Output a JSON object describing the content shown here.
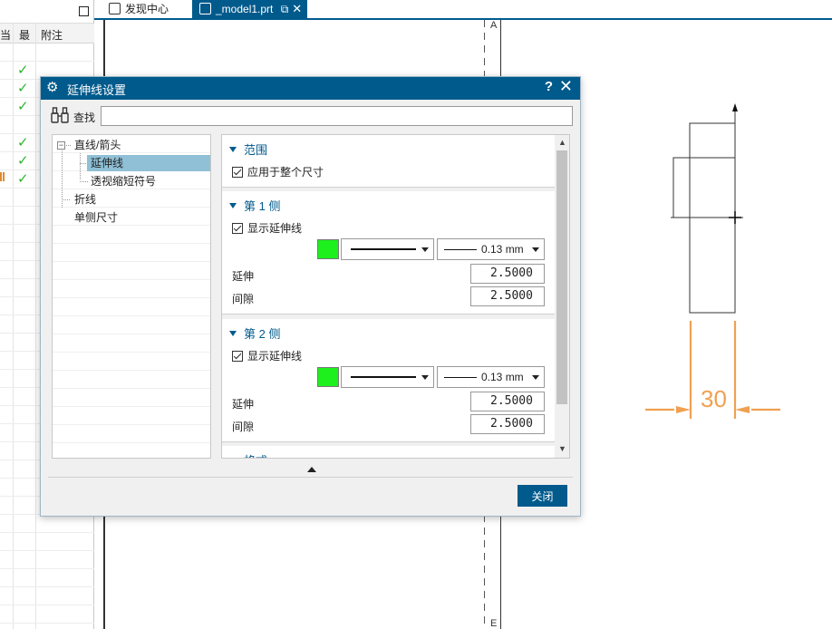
{
  "left_panel": {
    "columns": [
      "当",
      "最",
      "附注"
    ],
    "check_rows": [
      1,
      2,
      3,
      5,
      6,
      7
    ],
    "check_glyph": "✓"
  },
  "tabs": [
    {
      "label": "发现中心",
      "icon": "discovery-icon"
    },
    {
      "label": "_model1.prt",
      "icon": "part-file-icon",
      "active": true,
      "close": "✕"
    }
  ],
  "canvas": {
    "zone_letter_top": "A",
    "zone_letter_bottom": "E",
    "dimension_value": "30",
    "dimension_color": "#f0a050"
  },
  "dialog": {
    "title": "延伸线设置",
    "help": "?",
    "close_glyph": "✕",
    "find_label": "查找",
    "find_value": "",
    "tree": {
      "group_label": "直线/箭头",
      "items": [
        "延伸线",
        "透视缩短符号"
      ],
      "selected": "延伸线",
      "others": [
        "折线",
        "单侧尺寸"
      ]
    },
    "sections": {
      "range": {
        "title": "范围",
        "checkbox": "应用于整个尺寸"
      },
      "side1": {
        "title": "第 1 侧",
        "checkbox": "显示延伸线",
        "width": "0.13 mm",
        "extend_label": "延伸",
        "extend_value": "2.5000",
        "gap_label": "间隙",
        "gap_value": "2.5000"
      },
      "side2": {
        "title": "第 2 侧",
        "checkbox": "显示延伸线",
        "width": "0.13 mm",
        "extend_label": "延伸",
        "extend_value": "2.5000",
        "gap_label": "间隙",
        "gap_value": "2.5000"
      },
      "format": {
        "title": "格式"
      }
    },
    "swatch_color": "#1ef01e",
    "close_button": "关闭"
  },
  "colors": {
    "title_bar": "#005a8c",
    "selection": "#8fc0d6"
  }
}
